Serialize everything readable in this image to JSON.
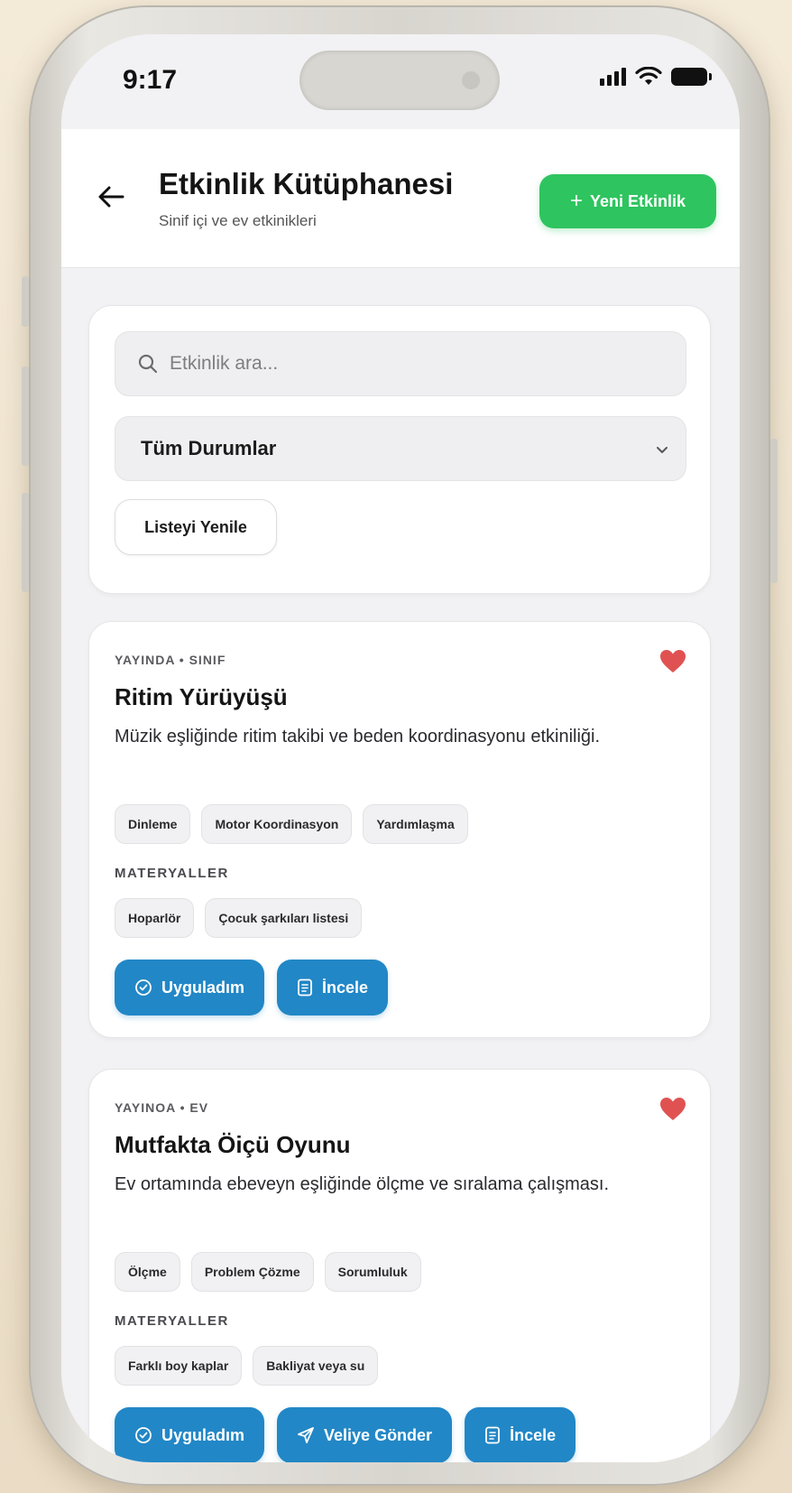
{
  "status_bar": {
    "time": "9:17"
  },
  "header": {
    "title": "Etkinlik Kütüphanesi",
    "subtitle": "Sinif içi ve ev etkinikleri",
    "new_button": "Yeni Etkinlik"
  },
  "filters": {
    "search_placeholder": "Etkinlik ara...",
    "status_select": "Tüm Durumlar",
    "refresh_button": "Listeyi Yenile"
  },
  "activities": [
    {
      "meta": "YAYINDA • SINIF",
      "title": "Ritim Yürüyüşü",
      "description": "Müzik eşliğinde ritim takibi ve beden koordinasyonu etkiniliği.",
      "tags": [
        "Dinleme",
        "Motor Koordinasyon",
        "Yardımlaşma"
      ],
      "materials_label": "MATERYALLER",
      "materials": [
        "Hoparlör",
        "Çocuk şarkıları listesi"
      ],
      "actions": [
        "Uyguladım",
        "İncele"
      ]
    },
    {
      "meta": "YAYINOA • EV",
      "title": "Mutfakta Öiçü Oyunu",
      "description": "Ev ortamında ebeveyn eşliğinde ölçme ve sıralama çalışması.",
      "tags": [
        "Ölçme",
        "Problem Çözme",
        "Sorumluluk"
      ],
      "materials_label": "MATERYALLER",
      "materials": [
        "Farklı boy kaplar",
        "Bakliyat veya su"
      ],
      "actions": [
        "Uyguladım",
        "Veliye Gönder",
        "İncele"
      ]
    }
  ],
  "colors": {
    "accent_green": "#2ec45f",
    "action_blue": "#2287c6",
    "heart_red": "#e05252"
  }
}
